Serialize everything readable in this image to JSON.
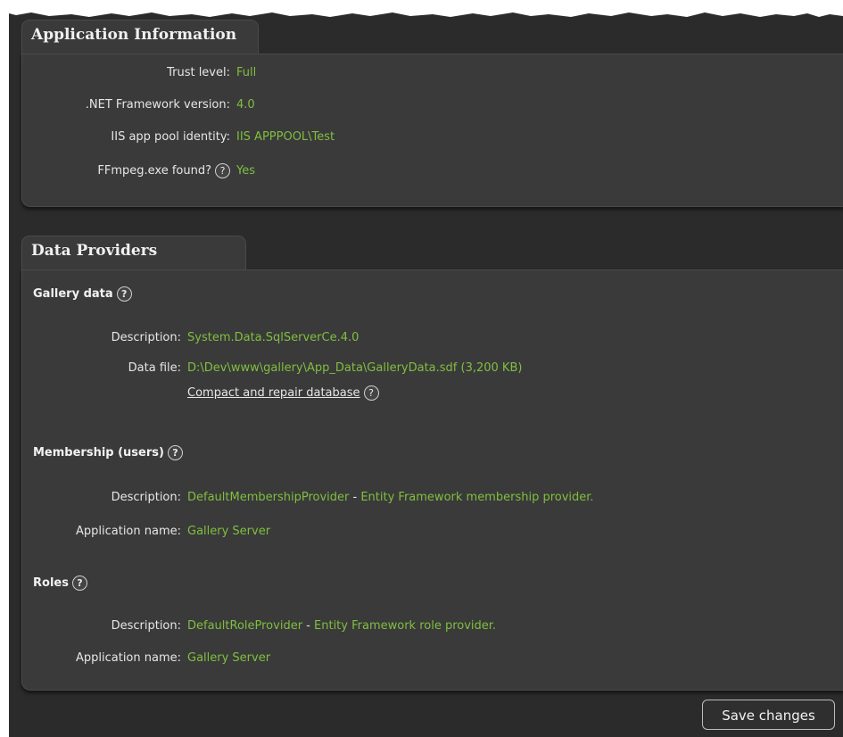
{
  "app_info": {
    "title": "Application Information",
    "trust_level_label": "Trust level:",
    "trust_level_value": "Full",
    "framework_label": ".NET Framework version:",
    "framework_value": "4.0",
    "pool_label": "IIS app pool identity:",
    "pool_value": "IIS APPPOOL\\Test",
    "ffmpeg_label": "FFmpeg.exe found?",
    "ffmpeg_value": "Yes"
  },
  "data_providers": {
    "title": "Data Providers",
    "gallery": {
      "heading": "Gallery data",
      "description_label": "Description:",
      "description_value": "System.Data.SqlServerCe.4.0",
      "datafile_label": "Data file:",
      "datafile_value": "D:\\Dev\\www\\gallery\\App_Data\\GalleryData.sdf (3,200 KB)",
      "compact_link": "Compact and repair database"
    },
    "membership": {
      "heading": "Membership (users)",
      "description_label": "Description:",
      "description_provider": "DefaultMembershipProvider",
      "description_sep": " - ",
      "description_text": "Entity Framework membership provider.",
      "appname_label": "Application name:",
      "appname_value": "Gallery Server"
    },
    "roles": {
      "heading": "Roles",
      "description_label": "Description:",
      "description_provider": "DefaultRoleProvider",
      "description_sep": " - ",
      "description_text": "Entity Framework role provider.",
      "appname_label": "Application name:",
      "appname_value": "Gallery Server"
    }
  },
  "help_glyph": "?",
  "save_button": "Save changes",
  "colors": {
    "value_green": "#7fbf3f",
    "panel_bg": "#3a3a3a",
    "page_bg": "#2b2b2b"
  }
}
